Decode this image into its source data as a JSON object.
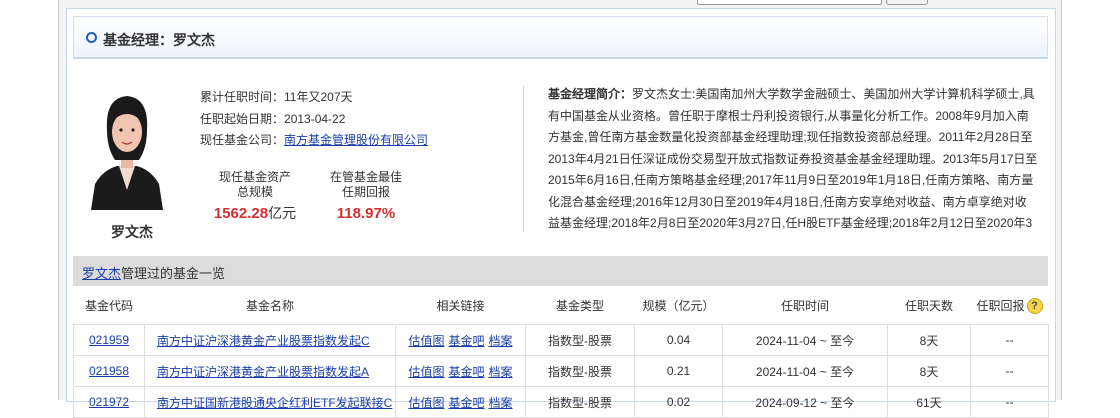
{
  "header": {
    "title": "基金经理：罗文杰"
  },
  "manager": {
    "name": "罗文杰",
    "tenure_label": "累计任职时间：",
    "tenure_value": "11年又207天",
    "start_label": "任职起始日期：",
    "start_value": "2013-04-22",
    "company_label": "现任基金公司：",
    "company_value": "南方基金管理股份有限公司",
    "stat_assets_line1": "现任基金资产",
    "stat_assets_line2": "总规模",
    "stat_assets_value": "1562.28",
    "stat_assets_unit": "亿元",
    "stat_return_line1": "在管基金最佳",
    "stat_return_line2": "任期回报",
    "stat_return_value": "118.97%",
    "bio_label": "基金经理简介：",
    "bio_text": "罗文杰女士:美国南加州大学数学金融硕士、美国加州大学计算机科学硕士,具有中国基金从业资格。曾任职于摩根士丹利投资银行,从事量化分析工作。2008年9月加入南方基金,曾任南方基金数量化投资部基金经理助理;现任指数投资部总经理。2011年2月28日至2013年4月21日任深证成份交易型开放式指数证券投资基金基金经理助理。2013年5月17日至2015年6月16日,任南方策略基金经理;2017年11月9日至2019年1月18日,任南方策略、南方量化混合基金经理;2016年12月30日至2019年4月18日,任南方安享绝对收益、南方卓享绝对收益基金经理;2018年2月8日至2020年3月27日,任H股ETF基金经理;2018年2月12日至2020年3"
  },
  "fund_list": {
    "name_link": "罗文杰",
    "title_suffix": "管理过的基金一览",
    "columns": [
      "基金代码",
      "基金名称",
      "相关链接",
      "基金类型",
      "规模（亿元）",
      "任职时间",
      "任职天数",
      "任职回报"
    ],
    "link_labels": [
      "估值图",
      "基金吧",
      "档案"
    ],
    "rows": [
      {
        "code": "021959",
        "name": "南方中证沪深港黄金产业股票指数发起C",
        "type": "指数型-股票",
        "size": "0.04",
        "period": "2024-11-04 ~ 至今",
        "days": "8天",
        "ret": "--"
      },
      {
        "code": "021958",
        "name": "南方中证沪深港黄金产业股票指数发起A",
        "type": "指数型-股票",
        "size": "0.21",
        "period": "2024-11-04 ~ 至今",
        "days": "8天",
        "ret": "--"
      },
      {
        "code": "021972",
        "name": "南方中证国新港股通央企红利ETF发起联接C",
        "type": "指数型-股票",
        "size": "0.02",
        "period": "2024-09-12 ~ 至今",
        "days": "61天",
        "ret": "--"
      }
    ]
  },
  "icons": {
    "header_bullet": "circle-bullet-icon",
    "help": "question-help-icon"
  },
  "colors": {
    "accent_blue": "#1f5fb8",
    "link": "#1a3fa8",
    "value_red": "#d32f2f"
  }
}
